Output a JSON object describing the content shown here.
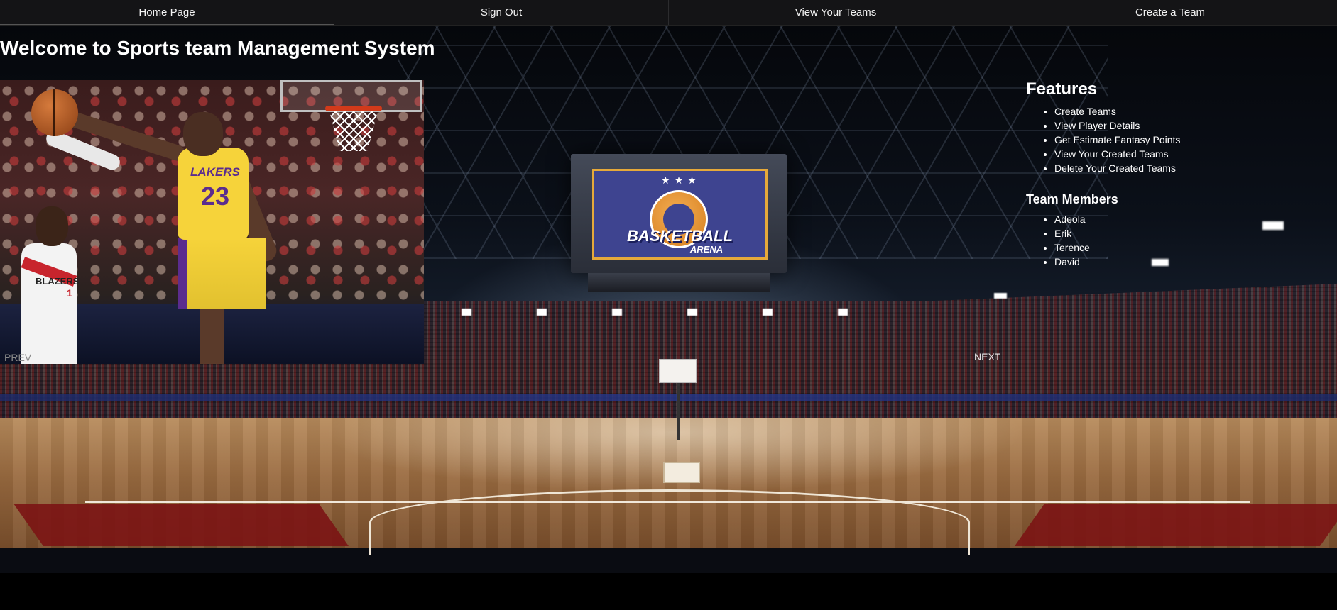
{
  "nav": {
    "items": [
      {
        "label": "Home Page"
      },
      {
        "label": "Sign Out"
      },
      {
        "label": "View Your Teams"
      },
      {
        "label": "Create a Team"
      }
    ]
  },
  "page": {
    "welcome": "Welcome to Sports team Management System"
  },
  "slideshow": {
    "prev_label": "PREV",
    "next_label": "NEXT",
    "photo": {
      "jersey_team": "LAKERS",
      "jersey_number": "23",
      "defender_team": "BLAZERS",
      "defender_number": "1"
    }
  },
  "background": {
    "jumbotron_title": "BASKETBALL",
    "jumbotron_subtitle": "ARENA",
    "stars": "★★★"
  },
  "panel": {
    "features_title": "Features",
    "features": [
      "Create Teams",
      "View Player Details",
      "Get Estimate Fantasy Points",
      "View Your Created Teams",
      "Delete Your Created Teams"
    ],
    "members_title": "Team Members",
    "members": [
      "Adeola",
      "Erik",
      "Terence",
      "David"
    ]
  },
  "colors": {
    "nav_bg": "#141416",
    "page_bg": "#000000",
    "text": "#ffffff",
    "jumbotron_blue": "#3e4490",
    "jumbotron_gold": "#e6a93a"
  }
}
